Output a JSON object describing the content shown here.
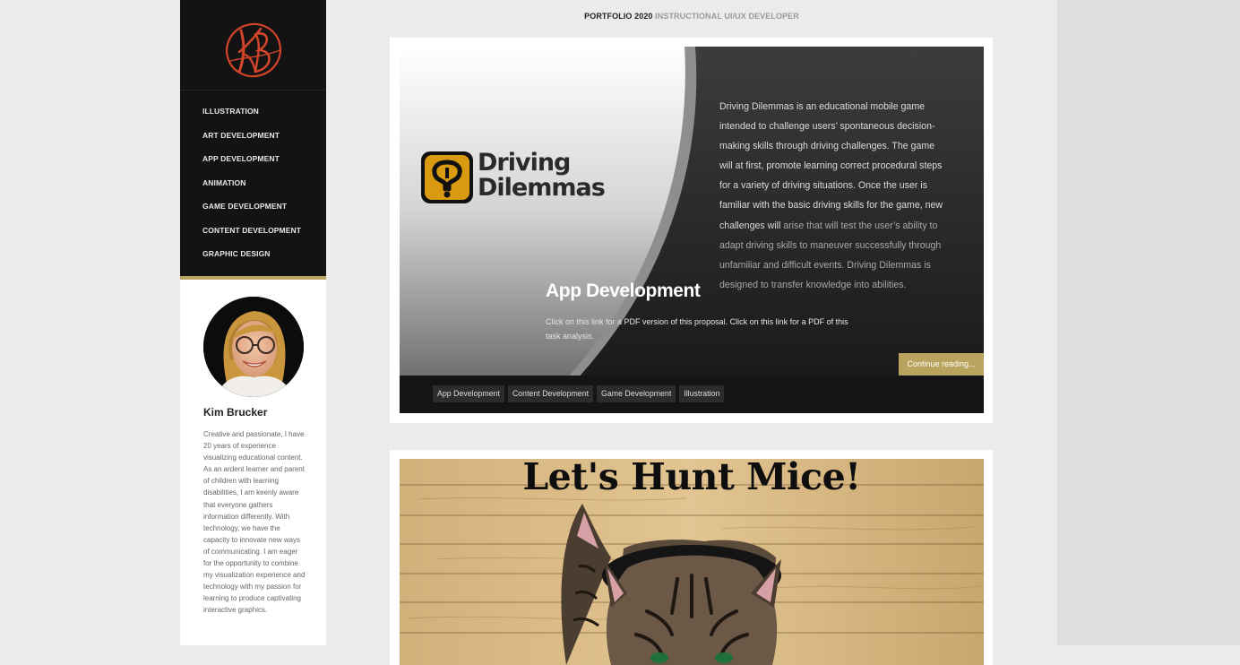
{
  "header": {
    "part1": "PORTFOLIO 2020",
    "part2": "INSTRUCTIONAL UI/UX DEVELOPER"
  },
  "sidebar": {
    "nav": [
      {
        "label": "ILLUSTRATION"
      },
      {
        "label": "ART DEVELOPMENT"
      },
      {
        "label": "APP DEVELOPMENT"
      },
      {
        "label": "ANIMATION"
      },
      {
        "label": "GAME DEVELOPMENT"
      },
      {
        "label": "CONTENT DEVELOPMENT"
      },
      {
        "label": "GRAPHIC DESIGN"
      }
    ],
    "profile": {
      "name": "Kim Brucker",
      "bio": "Creative and passionate, I have 20 years of experience visualizing educational content. As an ardent learner and parent of children with learning disabilities, I am keenly aware that everyone gathers information differently. With technology, we have the capacity to innovate new ways of communicating. I am eager for the opportunity to combine my visualization experience and technology with my passion for learning to produce captivating interactive graphics."
    }
  },
  "post1": {
    "logo_line1": "Driving",
    "logo_line2": "Dilemmas",
    "description": "Driving Dilemmas is an educational mobile game intended to challenge users’ spontaneous decision-making skills through driving challenges. The game will at first, promote learning correct procedural steps for a variety of driving situations. Once the user is familiar with the basic driving skills for the game, new challenges will",
    "description_fade": "arise that will test the user’s ability to adapt driving skills to maneuver successfully through unfamiliar and difficult events. Driving Dilemmas is designed to transfer knowledge into abilities.",
    "title": "App Development",
    "link1": "Click on this link for a PDF version of this proposal.",
    "link2": "Click on this link for a PDF of this task analysis.",
    "continue": "Continue reading...",
    "tags": [
      {
        "label": "App Development"
      },
      {
        "label": "Content Development"
      },
      {
        "label": "Game Development"
      },
      {
        "label": "Illustration"
      }
    ]
  },
  "post2": {
    "title": "Let's Hunt Mice!"
  },
  "colors": {
    "accent": "#b8a45e",
    "sidebar_bg": "#131313",
    "logo_red": "#d2452a"
  }
}
